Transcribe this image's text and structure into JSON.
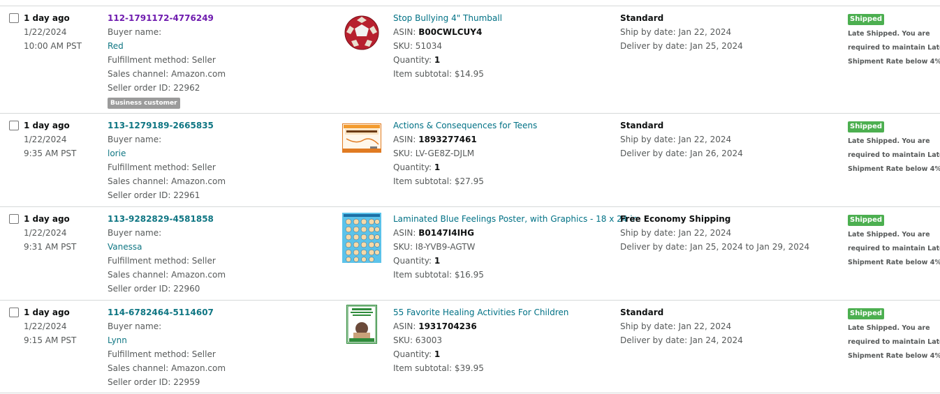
{
  "orders": [
    {
      "checked": false,
      "age": "1 day ago",
      "date": "1/22/2024",
      "time": "10:00 AM PST",
      "order_id": "112-1791172-4776249",
      "order_id_visited": true,
      "buyer_label": "Buyer name:",
      "buyer": "Red",
      "fulfillment": "Fulfillment method: Seller",
      "channel": "Sales channel: Amazon.com",
      "seller_order": "Seller order ID: 22962",
      "business_badge": "Business customer",
      "image_icon": "thumball-icon",
      "product_title": "Stop Bullying 4\" Thumball",
      "asin_label": "ASIN:",
      "asin": "B00CWLCUY4",
      "sku": "SKU: 51034",
      "qty_label": "Quantity:",
      "qty": "1",
      "subtotal": "Item subtotal: $14.95",
      "ship_service": "Standard",
      "ship_by": "Ship by date: Jan 22, 2024",
      "deliver_by": "Deliver by date: Jan 25, 2024",
      "status": "Shipped",
      "status_note": [
        "Late Shipped. You are",
        "required to maintain Late",
        "Shipment Rate below 4%"
      ]
    },
    {
      "checked": false,
      "age": "1 day ago",
      "date": "1/22/2024",
      "time": "9:35 AM PST",
      "order_id": "113-1279189-2665835",
      "order_id_visited": false,
      "buyer_label": "Buyer name:",
      "buyer": "lorie",
      "fulfillment": "Fulfillment method: Seller",
      "channel": "Sales channel: Amazon.com",
      "seller_order": "Seller order ID: 22961",
      "business_badge": "",
      "image_icon": "consequences-book-icon",
      "product_title": "Actions & Consequences for Teens",
      "asin_label": "ASIN:",
      "asin": "1893277461",
      "sku": "SKU: LV-GE8Z-DJLM",
      "qty_label": "Quantity:",
      "qty": "1",
      "subtotal": "Item subtotal: $27.95",
      "ship_service": "Standard",
      "ship_by": "Ship by date: Jan 22, 2024",
      "deliver_by": "Deliver by date: Jan 26, 2024",
      "status": "Shipped",
      "status_note": [
        "Late Shipped. You are",
        "required to maintain Late",
        "Shipment Rate below 4%"
      ]
    },
    {
      "checked": false,
      "age": "1 day ago",
      "date": "1/22/2024",
      "time": "9:31 AM PST",
      "order_id": "113-9282829-4581858",
      "order_id_visited": false,
      "buyer_label": "Buyer name:",
      "buyer": "Vanessa",
      "fulfillment": "Fulfillment method: Seller",
      "channel": "Sales channel: Amazon.com",
      "seller_order": "Seller order ID: 22960",
      "business_badge": "",
      "image_icon": "feelings-poster-icon",
      "product_title": "Laminated Blue Feelings Poster, with Graphics - 18 x 24 in.",
      "asin_label": "ASIN:",
      "asin": "B0147I4IHG",
      "sku": "SKU: I8-YVB9-AGTW",
      "qty_label": "Quantity:",
      "qty": "1",
      "subtotal": "Item subtotal: $16.95",
      "ship_service": "Free Economy Shipping",
      "ship_by": "Ship by date: Jan 22, 2024",
      "deliver_by": "Deliver by date: Jan 25, 2024 to Jan 29, 2024",
      "status": "Shipped",
      "status_note": [
        "Late Shipped. You are",
        "required to maintain Late",
        "Shipment Rate below 4%"
      ]
    },
    {
      "checked": false,
      "age": "1 day ago",
      "date": "1/22/2024",
      "time": "9:15 AM PST",
      "order_id": "114-6782464-5114607",
      "order_id_visited": false,
      "buyer_label": "Buyer name:",
      "buyer": "Lynn",
      "fulfillment": "Fulfillment method: Seller",
      "channel": "Sales channel: Amazon.com",
      "seller_order": "Seller order ID: 22959",
      "business_badge": "",
      "image_icon": "healing-book-icon",
      "product_title": "55 Favorite Healing Activities For Children",
      "asin_label": "ASIN:",
      "asin": "1931704236",
      "sku": "SKU: 63003",
      "qty_label": "Quantity:",
      "qty": "1",
      "subtotal": "Item subtotal: $39.95",
      "ship_service": "Standard",
      "ship_by": "Ship by date: Jan 22, 2024",
      "deliver_by": "Deliver by date: Jan 24, 2024",
      "status": "Shipped",
      "status_note": [
        "Late Shipped. You are",
        "required to maintain Late",
        "Shipment Rate below 4%"
      ]
    }
  ]
}
